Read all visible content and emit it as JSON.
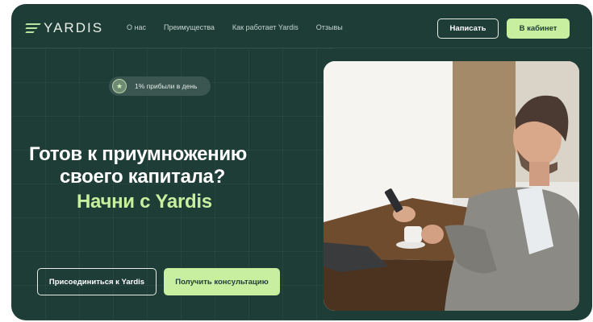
{
  "header": {
    "logo_text": "YARDIS",
    "nav": [
      "О нас",
      "Преимущества",
      "Как работает Yardis",
      "Отзывы"
    ],
    "write_label": "Написать",
    "cabinet_label": "В кабинет"
  },
  "badge": {
    "icon": "star-icon",
    "text": "1% прибыли в день"
  },
  "hero": {
    "line1": "Готов к приумножению",
    "line2": "своего капитала?",
    "line3": "Начни с Yardis"
  },
  "actions": {
    "join_label": "Присоединиться к Yardis",
    "consult_label": "Получить консультацию"
  },
  "colors": {
    "background": "#1f3d37",
    "accent": "#c8ef9f",
    "text": "#ffffff"
  }
}
